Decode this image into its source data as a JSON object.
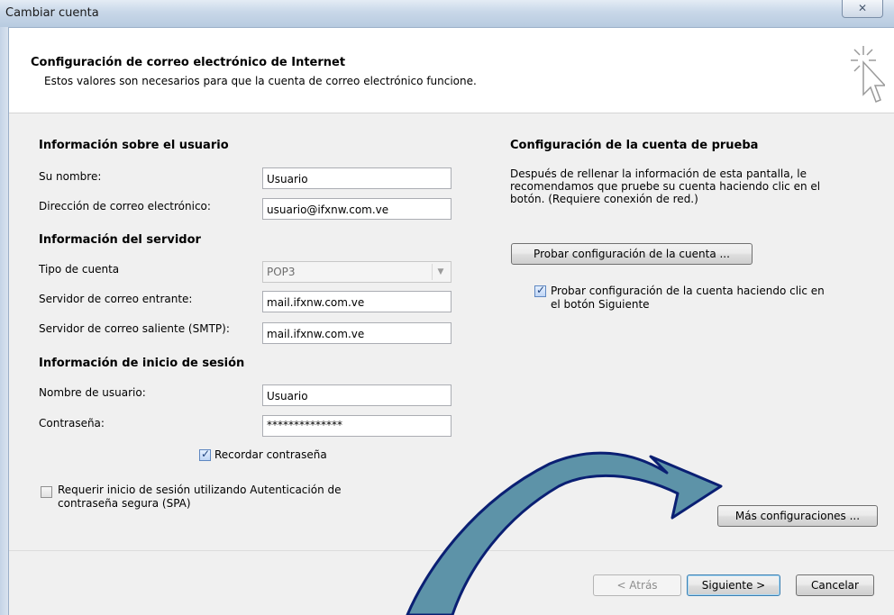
{
  "window": {
    "title": "Cambiar cuenta",
    "close_glyph": "✕"
  },
  "header": {
    "title": "Configuración de correo electrónico de Internet",
    "subtitle": "Estos valores son necesarios para que la cuenta de correo electrónico funcione.",
    "icon": "cursor-sparkle-icon"
  },
  "user_info": {
    "heading": "Información sobre el usuario",
    "name_label": "Su nombre:",
    "name_value": "Usuario",
    "email_label": "Dirección de correo electrónico:",
    "email_value": "usuario@ifxnw.com.ve"
  },
  "server_info": {
    "heading": "Información del servidor",
    "account_type_label": "Tipo de cuenta",
    "account_type_value": "POP3",
    "incoming_label": "Servidor de correo entrante:",
    "incoming_value": "mail.ifxnw.com.ve",
    "outgoing_label": "Servidor de correo saliente (SMTP):",
    "outgoing_value": "mail.ifxnw.com.ve"
  },
  "login_info": {
    "heading": "Información de inicio de sesión",
    "username_label": "Nombre de usuario:",
    "username_value": "Usuario",
    "password_label": "Contraseña:",
    "password_value": "**************",
    "remember_label": "Recordar contraseña",
    "remember_checked": true,
    "spa_label_line1": "Requerir inicio de sesión utilizando Autenticación de",
    "spa_label_line2": "contraseña segura (SPA)",
    "spa_checked": false
  },
  "test_settings": {
    "heading": "Configuración de la cuenta de prueba",
    "description_line1": "Después de rellenar la información de esta pantalla, le",
    "description_line2": "recomendamos que pruebe su cuenta haciendo clic en el",
    "description_line3": "botón. (Requiere conexión de red.)",
    "test_button": "Probar configuración de la cuenta ...",
    "auto_test_label_line1": "Probar configuración de la cuenta haciendo clic en",
    "auto_test_label_line2": "el botón Siguiente",
    "auto_test_checked": true
  },
  "more_settings_button": "Más configuraciones ...",
  "footer": {
    "back": "< Atrás",
    "next": "Siguiente >",
    "cancel": "Cancelar"
  },
  "colors": {
    "arrow_fill": "#5d93a8",
    "arrow_stroke": "#0a1f73",
    "title_gradient": "#c8d7e8"
  }
}
